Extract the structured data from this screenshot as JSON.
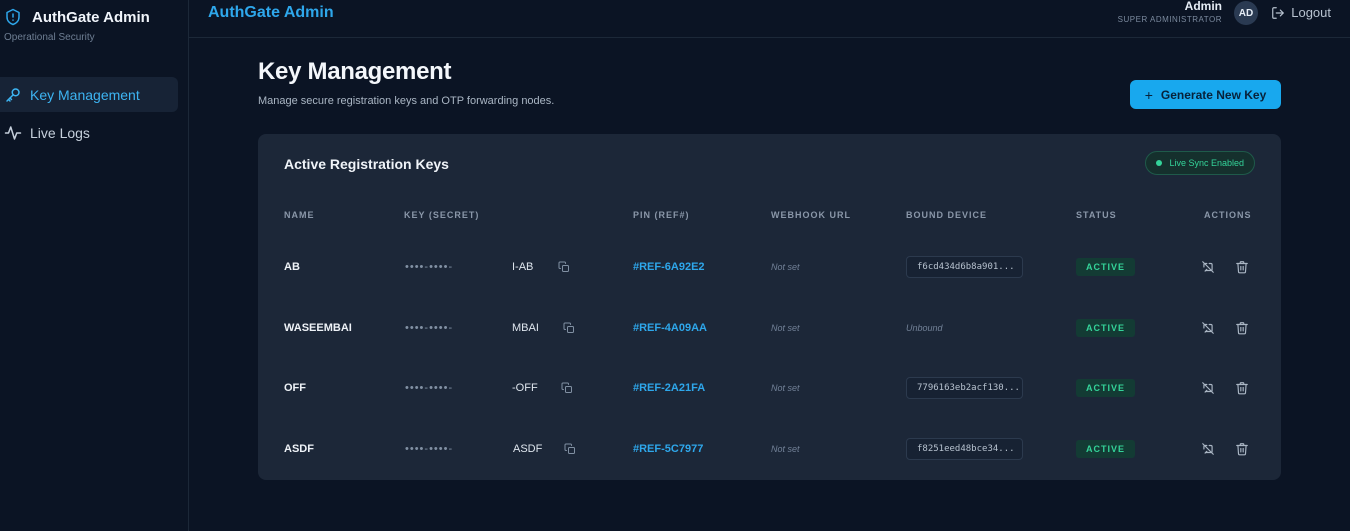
{
  "colors": {
    "accent": "#18a8ee",
    "link": "#2ea7eb",
    "status_active": "#34d399",
    "background": "#0b1424",
    "card": "#1c2738"
  },
  "sidebar": {
    "brand_name": "AuthGate Admin",
    "brand_sub": "Operational Security",
    "brand_icon": "shield-icon",
    "items": [
      {
        "label": "Key Management",
        "icon": "key-icon",
        "active": true
      },
      {
        "label": "Live Logs",
        "icon": "activity-icon",
        "active": false
      }
    ]
  },
  "header": {
    "title": "AuthGate Admin",
    "user_name": "Admin",
    "user_role": "SUPER ADMINISTRATOR",
    "avatar_initials": "AD",
    "logout_label": "Logout"
  },
  "main": {
    "title": "Key Management",
    "subtitle": "Manage secure registration keys and OTP forwarding nodes.",
    "generate_button": "Generate New Key"
  },
  "card": {
    "title": "Active Registration Keys",
    "sync_badge": "Live Sync Enabled",
    "columns": [
      "NAME",
      "KEY (SECRET)",
      "PIN (REF#)",
      "WEBHOOK URL",
      "BOUND DEVICE",
      "STATUS",
      "ACTIONS"
    ],
    "rows": [
      {
        "name": "AB",
        "key_mask": "••••-••••-",
        "key_suffix": "I-AB",
        "pin": "#REF-6A92E2",
        "webhook": "Not set",
        "device": "f6cd434d6b8a901...",
        "status": "ACTIVE"
      },
      {
        "name": "WASEEMBAI",
        "key_mask": "••••-••••-",
        "key_suffix": "MBAI",
        "pin": "#REF-4A09AA",
        "webhook": "Not set",
        "device": "Unbound",
        "status": "ACTIVE"
      },
      {
        "name": "OFF",
        "key_mask": "••••-••••-",
        "key_suffix": "-OFF",
        "pin": "#REF-2A21FA",
        "webhook": "Not set",
        "device": "7796163eb2acf130...",
        "status": "ACTIVE"
      },
      {
        "name": "ASDF",
        "key_mask": "••••-••••-",
        "key_suffix": "ASDF",
        "pin": "#REF-5C7977",
        "webhook": "Not set",
        "device": "f8251eed48bce34...",
        "status": "ACTIVE"
      }
    ]
  }
}
